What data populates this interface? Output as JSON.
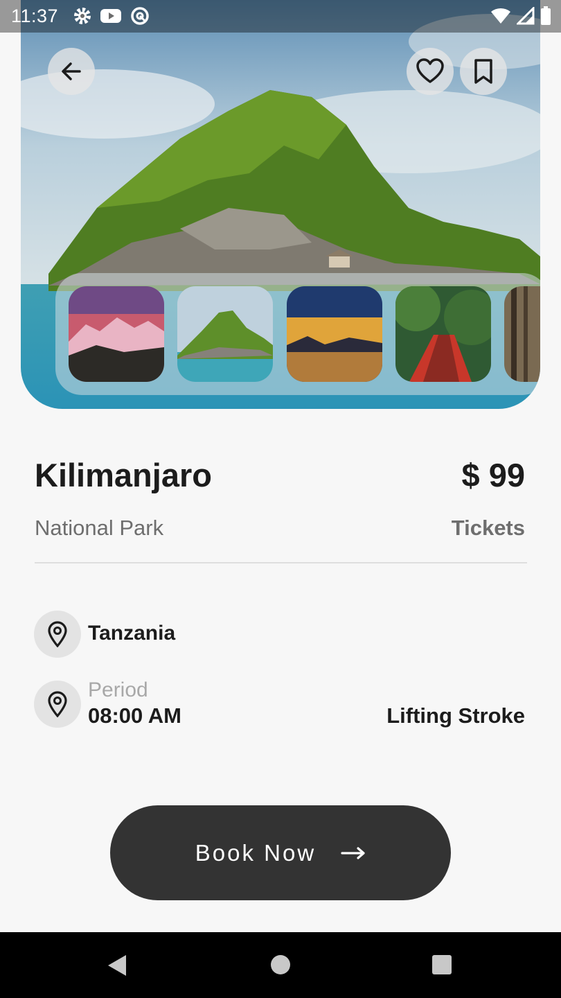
{
  "status_bar": {
    "time": "11:37",
    "left_icons": [
      "settings-icon",
      "youtube-icon",
      "at-sign-icon"
    ],
    "right_icons": [
      "wifi-icon",
      "signal-icon",
      "battery-icon"
    ]
  },
  "header": {
    "back_icon": "arrow-left-icon",
    "favorite_icon": "heart-icon",
    "bookmark_icon": "bookmark-icon"
  },
  "gallery": {
    "thumbnails": [
      "snowy-mountains-sunset",
      "green-island",
      "sunset-lake",
      "forest-bridge",
      "forest-trees"
    ]
  },
  "place": {
    "name": "Kilimanjaro",
    "price": "$ 99",
    "category": "National Park",
    "price_label": "Tickets"
  },
  "details": {
    "location": "Tanzania",
    "period_label": "Period",
    "period_time": "08:00 AM",
    "activity": "Lifting Stroke"
  },
  "cta": {
    "label": "Book Now",
    "icon": "arrow-right-icon"
  },
  "nav": {
    "items": [
      "back-nav-icon",
      "home-nav-icon",
      "recents-nav-icon"
    ]
  }
}
